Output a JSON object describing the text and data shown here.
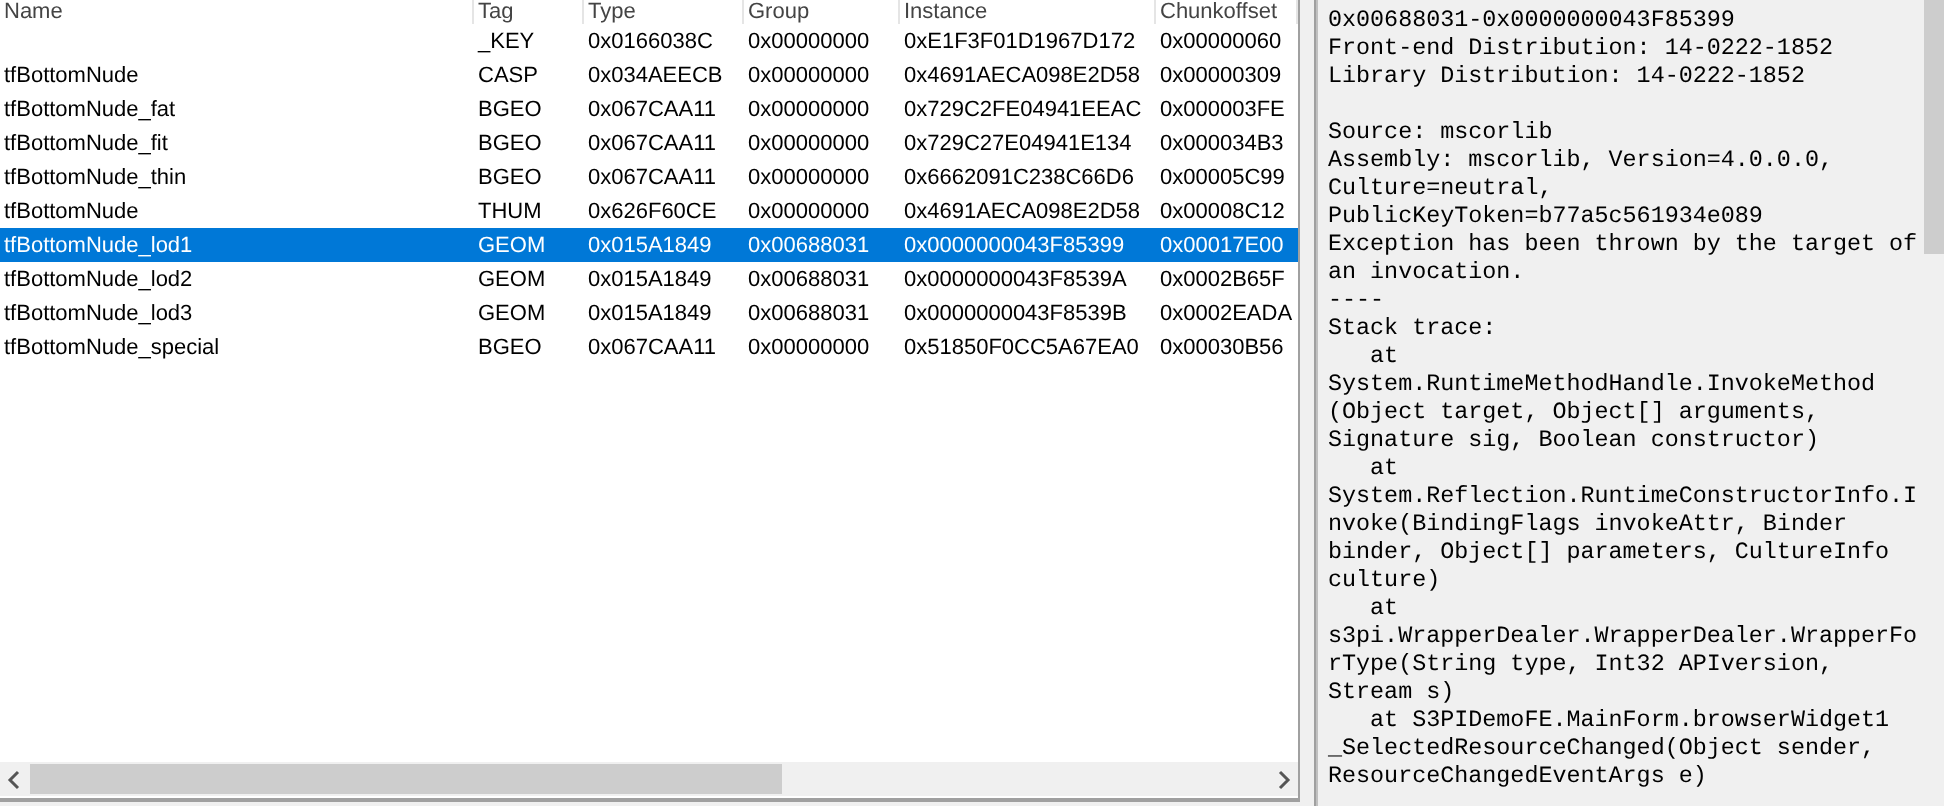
{
  "resource_list": {
    "columns": [
      "Name",
      "Tag",
      "Type",
      "Group",
      "Instance",
      "Chunkoffset"
    ],
    "rows": [
      {
        "cells": [
          "",
          "_KEY",
          "0x0166038C",
          "0x00000000",
          "0xE1F3F01D1967D172",
          "0x00000060"
        ],
        "selected": false
      },
      {
        "cells": [
          "tfBottomNude",
          "CASP",
          "0x034AEECB",
          "0x00000000",
          "0x4691AECA098E2D58",
          "0x00000309"
        ],
        "selected": false
      },
      {
        "cells": [
          "tfBottomNude_fat",
          "BGEO",
          "0x067CAA11",
          "0x00000000",
          "0x729C2FE04941EEAC",
          "0x000003FE"
        ],
        "selected": false
      },
      {
        "cells": [
          "tfBottomNude_fit",
          "BGEO",
          "0x067CAA11",
          "0x00000000",
          "0x729C27E04941E134",
          "0x000034B3"
        ],
        "selected": false
      },
      {
        "cells": [
          "tfBottomNude_thin",
          "BGEO",
          "0x067CAA11",
          "0x00000000",
          "0x6662091C238C66D6",
          "0x00005C99"
        ],
        "selected": false
      },
      {
        "cells": [
          "tfBottomNude",
          "THUM",
          "0x626F60CE",
          "0x00000000",
          "0x4691AECA098E2D58",
          "0x00008C12"
        ],
        "selected": false
      },
      {
        "cells": [
          "tfBottomNude_lod1",
          "GEOM",
          "0x015A1849",
          "0x00688031",
          "0x0000000043F85399",
          "0x00017E00"
        ],
        "selected": true
      },
      {
        "cells": [
          "tfBottomNude_lod2",
          "GEOM",
          "0x015A1849",
          "0x00688031",
          "0x0000000043F8539A",
          "0x0002B65F"
        ],
        "selected": false
      },
      {
        "cells": [
          "tfBottomNude_lod3",
          "GEOM",
          "0x015A1849",
          "0x00688031",
          "0x0000000043F8539B",
          "0x0002EADA"
        ],
        "selected": false
      },
      {
        "cells": [
          "tfBottomNude_special",
          "BGEO",
          "0x067CAA11",
          "0x00000000",
          "0x51850F0CC5A67EA0",
          "0x00030B56"
        ],
        "selected": false
      }
    ]
  },
  "error_text": {
    "blocks": [
      [
        "0x00688031-0x0000000043F85399",
        "Front-end Distribution: 14-0222-1852",
        "Library Distribution: 14-0222-1852"
      ],
      [
        "Source: mscorlib",
        "Assembly: mscorlib, Version=4.0.0.0,",
        "Culture=neutral,",
        "PublicKeyToken=b77a5c561934e089",
        "Exception has been thrown by the target of",
        "an invocation.",
        "----",
        "Stack trace:",
        "   at",
        "System.RuntimeMethodHandle.InvokeMethod",
        "(Object target, Object[] arguments,",
        "Signature sig, Boolean constructor)",
        "   at",
        "System.Reflection.RuntimeConstructorInfo.I",
        "nvoke(BindingFlags invokeAttr, Binder",
        "binder, Object[] parameters, CultureInfo",
        "culture)",
        "   at",
        "s3pi.WrapperDealer.WrapperDealer.WrapperFo",
        "rType(String type, Int32 APIversion,",
        "Stream s)",
        "   at S3PIDemoFE.MainForm.browserWidget1",
        "_SelectedResourceChanged(Object sender,",
        "ResourceChangedEventArgs e)"
      ]
    ]
  }
}
